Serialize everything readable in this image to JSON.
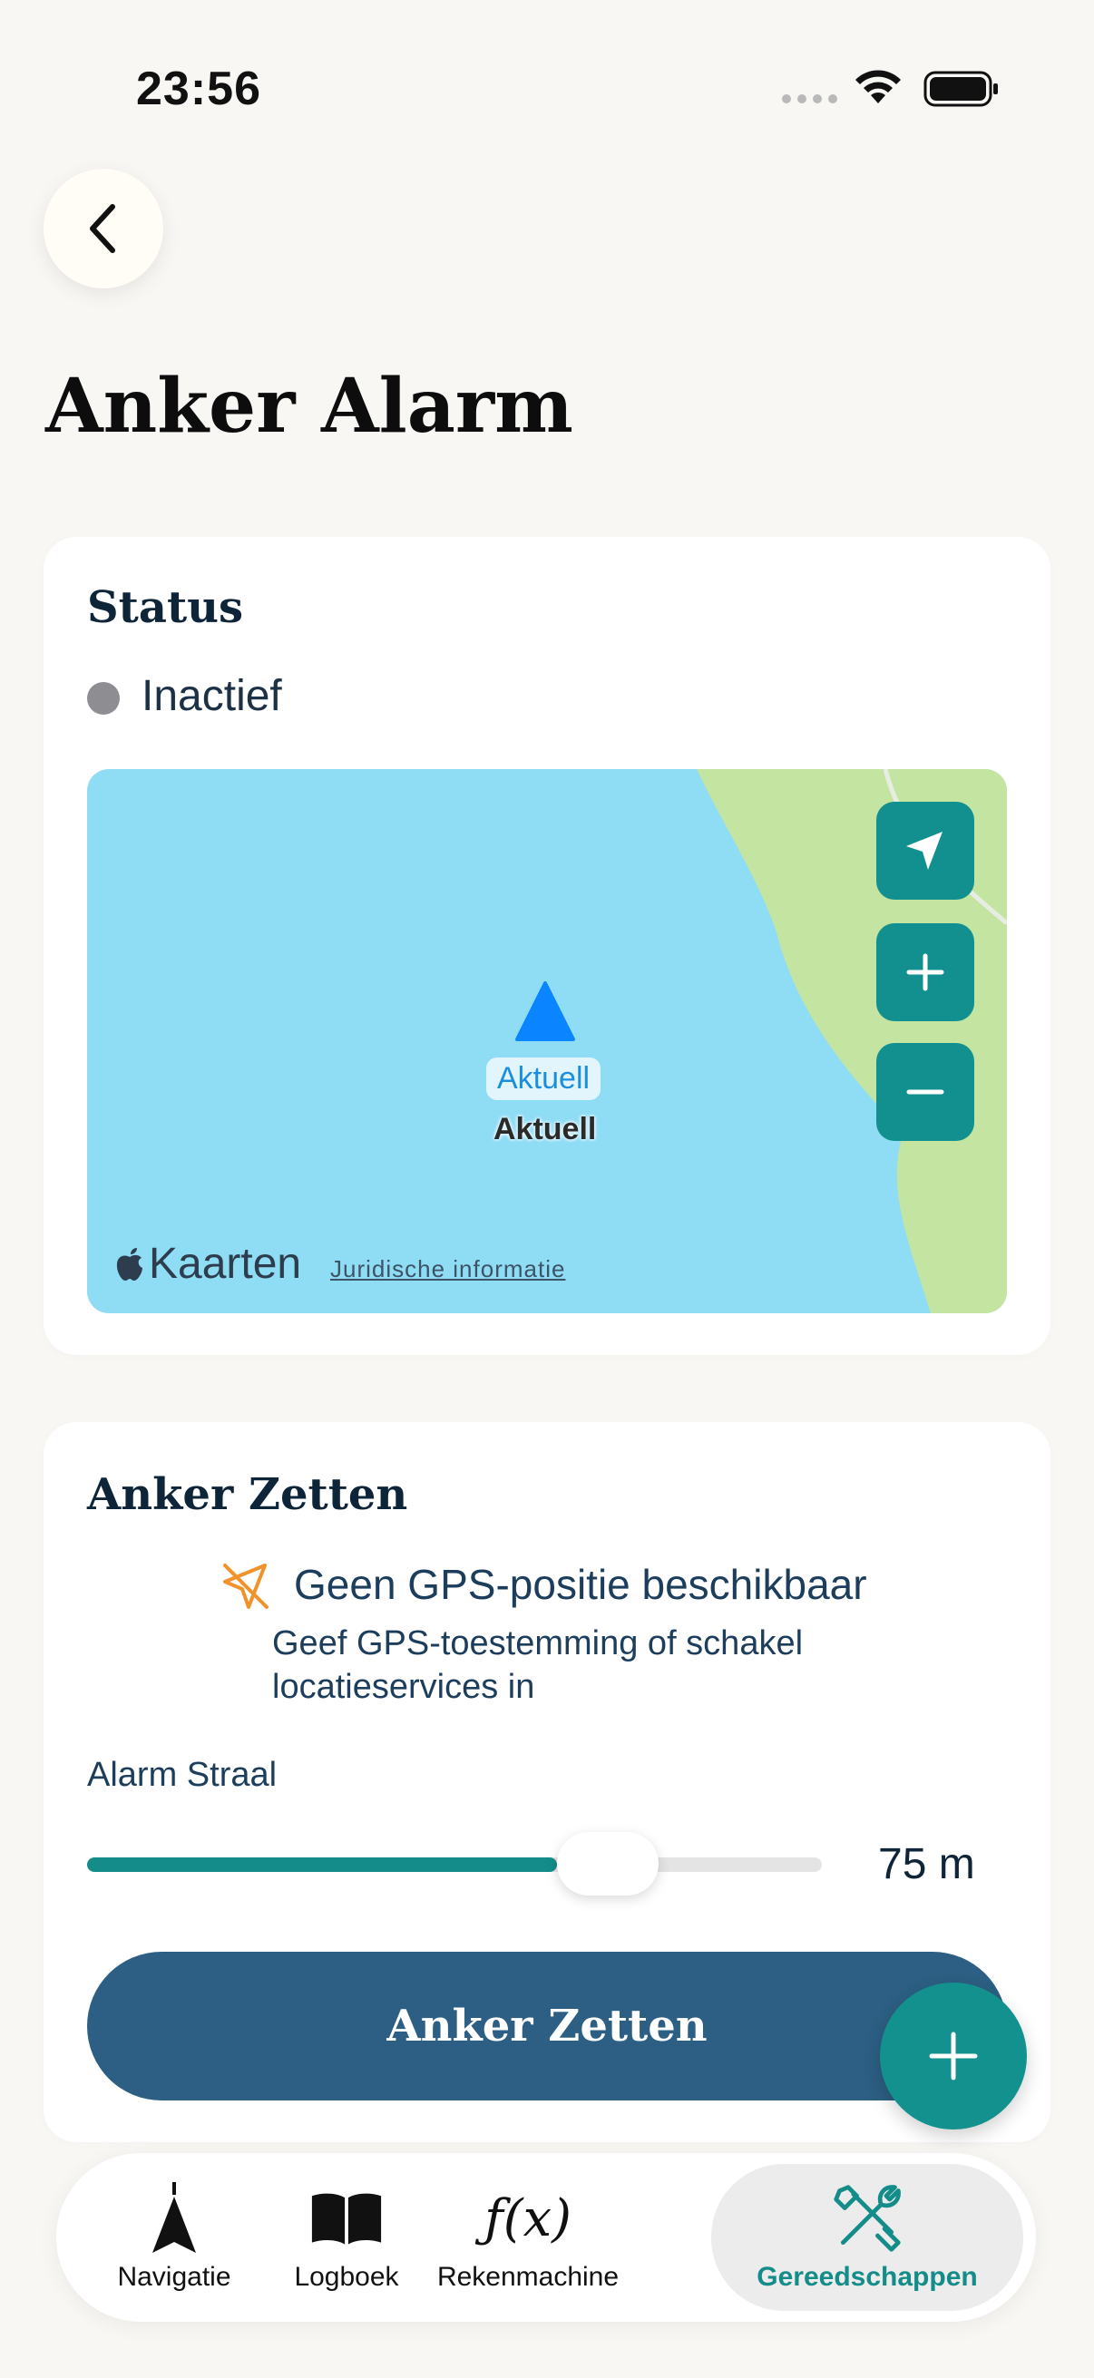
{
  "status_bar": {
    "time": "23:56"
  },
  "header": {
    "title": "Anker Alarm"
  },
  "status_card": {
    "title": "Status",
    "state": "Inactief",
    "state_color": "#8d8d92",
    "map": {
      "current_pill": "Aktuell",
      "current_label": "Aktuell",
      "maps_brand": "Kaarten",
      "legal_link": "Juridische informatie",
      "buttons": [
        "locate-arrow-icon",
        "zoom-in-icon",
        "zoom-out-icon"
      ]
    }
  },
  "anchor_card": {
    "title": "Anker Zetten",
    "gps_title": "Geen GPS-positie beschikbaar",
    "gps_subtitle": "Geef GPS-toestemming of schakel locatieservices in",
    "radius_label": "Alarm Straal",
    "radius_value": "75 m",
    "radius_fraction": 0.64,
    "button_label": "Anker Zetten"
  },
  "tabbar": {
    "items": [
      {
        "label": "Navigatie",
        "icon": "navigation-icon"
      },
      {
        "label": "Logboek",
        "icon": "book-icon"
      },
      {
        "label": "Rekenmachine",
        "icon": "function-icon"
      },
      {
        "label": "Gereedschappen",
        "icon": "tools-icon",
        "active": true
      }
    ]
  },
  "colors": {
    "accent": "#148d8a",
    "primary_button": "#2c5f83",
    "water": "#8fdcf5",
    "land": "#c4e5a1"
  }
}
